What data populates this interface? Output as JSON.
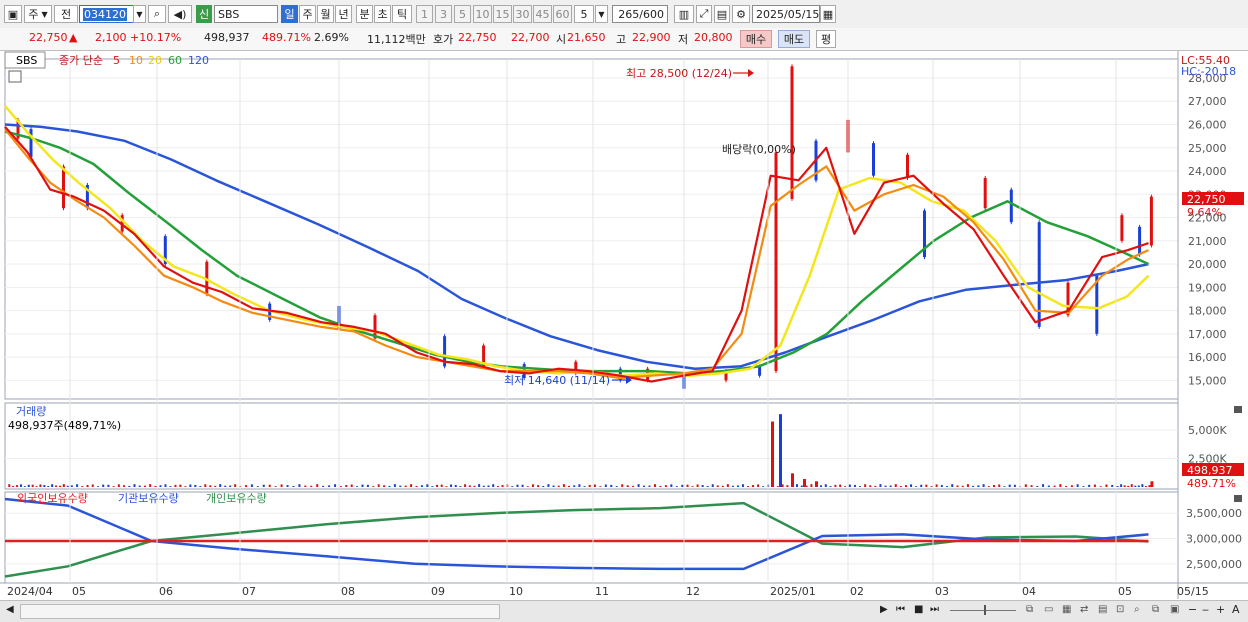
{
  "toolbar": {
    "period_unit": "주",
    "prev_label": "전",
    "code": "034120",
    "new_badge": "신",
    "stock_name": "SBS",
    "periods": [
      "일",
      "주",
      "월",
      "년",
      "분",
      "초",
      "틱"
    ],
    "active_period": "일",
    "intervals": [
      "1",
      "3",
      "5",
      "10",
      "15",
      "30",
      "45",
      "60"
    ],
    "interval_value": "5",
    "count": "265",
    "count_total": "/600",
    "date": "2025/05/15"
  },
  "quote": {
    "price": "22,750",
    "change_arrow": "▲",
    "change": "2,100",
    "change_pct": "+10.17%",
    "volume": "498,937",
    "volume_ratio": "489.71%",
    "turnover": "2.69%",
    "amount": "11,112백만",
    "bid_label": "호가",
    "ask_price": "22,750",
    "bid_price": "22,700",
    "open_label": "시",
    "open": "21,650",
    "high_label": "고",
    "high": "22,900",
    "low_label": "저",
    "low": "20,800",
    "buy_button": "매수",
    "sell_button": "매도",
    "eval_button": "평"
  },
  "colors": {
    "up": "#e01010",
    "down": "#1a3fd9",
    "ma5": "#e01010",
    "ma10": "#f28b10",
    "ma20": "#f4e61b",
    "ma60": "#23a038",
    "ma120": "#2a55d8",
    "foreign": "#e02020",
    "institution": "#2a55d8",
    "individual": "#2f8f4e"
  },
  "chart_data": [
    {
      "type": "candlestick",
      "title": "SBS",
      "series_label": "종가 단순",
      "ma_periods": [
        "5",
        "10",
        "20",
        "60",
        "120"
      ],
      "legend_labels": [
        "5",
        "10",
        "20",
        "60",
        "120"
      ],
      "ylim": [
        14000,
        28500
      ],
      "y_ticks": [
        "15,000",
        "16,000",
        "17,000",
        "18,000",
        "19,000",
        "20,000",
        "21,000",
        "22,000",
        "23,000",
        "24,000",
        "25,000",
        "26,000",
        "27,000",
        "28,000"
      ],
      "x_labels": [
        "2024/04",
        "05",
        "06",
        "07",
        "08",
        "09",
        "10",
        "11",
        "12",
        "2025/01",
        "02",
        "03",
        "04",
        "05",
        "05/15"
      ],
      "high_annotation": "최고 28,500 (12/24)",
      "low_annotation": "최저 14,640 (11/14)",
      "dividend_annotation": "배당락(0,00%)",
      "lc": "LC:55.40",
      "hc": "HC:-20.18",
      "last_price": "22,750",
      "last_change": "9.64%",
      "close_path": [
        [
          "2024/04",
          25800
        ],
        [
          "2024/04",
          24600
        ],
        [
          "2024/04",
          23100
        ],
        [
          "05",
          23000
        ],
        [
          "05",
          22400
        ],
        [
          "05",
          21500
        ],
        [
          "05",
          20000
        ],
        [
          "06",
          19200
        ],
        [
          "06",
          19100
        ],
        [
          "06",
          18700
        ],
        [
          "06",
          18000
        ],
        [
          "07",
          18200
        ],
        [
          "07",
          17600
        ],
        [
          "07",
          17300
        ],
        [
          "07",
          17200
        ],
        [
          "08",
          16900
        ],
        [
          "08",
          16000
        ],
        [
          "08",
          15600
        ],
        [
          "08",
          15800
        ],
        [
          "09",
          15900
        ],
        [
          "09",
          15300
        ],
        [
          "09",
          15200
        ],
        [
          "10",
          15500
        ],
        [
          "10",
          15600
        ],
        [
          "10",
          15400
        ],
        [
          "11",
          15300
        ],
        [
          "11",
          15000
        ],
        [
          "11",
          14800
        ],
        [
          "12",
          15200
        ],
        [
          "12",
          15300
        ],
        [
          "12",
          15500
        ],
        [
          "12",
          24500
        ],
        [
          "2025/01",
          23000
        ],
        [
          "2025/01",
          24500
        ],
        [
          "2025/01",
          25000
        ],
        [
          "02",
          21000
        ],
        [
          "02",
          23500
        ],
        [
          "02",
          24000
        ],
        [
          "03",
          23000
        ],
        [
          "03",
          22500
        ],
        [
          "03",
          21000
        ],
        [
          "04",
          18500
        ],
        [
          "04",
          17500
        ],
        [
          "04",
          18500
        ],
        [
          "05",
          20500
        ],
        [
          "05",
          20650
        ],
        [
          "05/15",
          22750
        ]
      ],
      "ma_paths": {
        "5": [
          25900,
          24800,
          23200,
          22900,
          22300,
          21300,
          19900,
          19200,
          18800,
          18100,
          17900,
          17500,
          17300,
          17000,
          16200,
          15800,
          15700,
          15400,
          15300,
          15500,
          15400,
          15200,
          14950,
          15200,
          15400,
          18000,
          23800,
          23600,
          25000,
          21300,
          23500,
          23800,
          22600,
          21500,
          19500,
          17500,
          18000,
          20300,
          20600,
          20900
        ],
        "10": [
          25800,
          24600,
          23500,
          22800,
          22000,
          20800,
          19500,
          19000,
          18400,
          17900,
          17600,
          17300,
          17100,
          16500,
          16000,
          15800,
          15600,
          15400,
          15400,
          15400,
          15300,
          15100,
          15200,
          15300,
          15500,
          17000,
          22500,
          23400,
          24200,
          22300,
          23000,
          23400,
          22900,
          21800,
          20200,
          18000,
          17900,
          19500,
          20200,
          20600
        ],
        "20": [
          26800,
          25600,
          24500,
          23500,
          22400,
          21000,
          19900,
          19400,
          18700,
          18000,
          17600,
          17300,
          17100,
          16600,
          16100,
          15900,
          15600,
          15400,
          15300,
          15400,
          15200,
          15300,
          15200,
          15300,
          15500,
          16500,
          19500,
          23200,
          23700,
          23500,
          22700,
          22300,
          21000,
          19000,
          18200,
          18100,
          18600,
          19500
        ],
        "60": [
          25700,
          25400,
          25000,
          24300,
          23000,
          21800,
          20600,
          19500,
          18600,
          17700,
          17100,
          16600,
          16100,
          15800,
          15600,
          15500,
          15400,
          15400,
          15400,
          15300,
          15400,
          15600,
          16200,
          17000,
          18400,
          19700,
          21000,
          22000,
          22700,
          21800,
          21200,
          20500,
          20000
        ],
        "120": [
          26000,
          25900,
          25700,
          25300,
          24500,
          23600,
          22700,
          21700,
          20700,
          19700,
          18500,
          17700,
          16900,
          16300,
          15800,
          15500,
          15600,
          16200,
          16900,
          17600,
          18400,
          18900,
          19100,
          19300,
          19700,
          20000
        ]
      },
      "bullish_candles": [
        [
          0.2,
          26200,
          25400
        ],
        [
          0.9,
          24200,
          22400
        ],
        [
          1.6,
          22100,
          21400
        ],
        [
          2.6,
          20100,
          18700
        ],
        [
          4.4,
          17800,
          16800
        ],
        [
          5.7,
          16500,
          15600
        ],
        [
          6.8,
          15800,
          15300
        ],
        [
          7.6,
          15500,
          15000
        ],
        [
          8.5,
          15400,
          15000
        ],
        [
          9.1,
          24800,
          15400
        ],
        [
          9.3,
          28500,
          22800
        ],
        [
          10.0,
          26200,
          24800
        ],
        [
          10.7,
          24700,
          23700
        ],
        [
          11.6,
          23700,
          22400
        ],
        [
          12.5,
          19200,
          17800
        ],
        [
          13.1,
          22100,
          21000
        ],
        [
          13.6,
          22900,
          20800
        ]
      ],
      "bearish_candles": [
        [
          0.4,
          25800,
          24600
        ],
        [
          1.2,
          23400,
          22400
        ],
        [
          2.1,
          21200,
          20000
        ],
        [
          3.3,
          18300,
          17600
        ],
        [
          4.0,
          18200,
          17200
        ],
        [
          5.2,
          16900,
          15600
        ],
        [
          6.2,
          15700,
          15100
        ],
        [
          7.3,
          15500,
          15000
        ],
        [
          8.0,
          15200,
          14640
        ],
        [
          8.9,
          15600,
          15200
        ],
        [
          9.6,
          25300,
          23600
        ],
        [
          10.3,
          25200,
          23800
        ],
        [
          10.9,
          22300,
          20300
        ],
        [
          11.9,
          23200,
          21800
        ],
        [
          12.2,
          21800,
          17300
        ],
        [
          12.8,
          19500,
          17000
        ],
        [
          13.4,
          21600,
          20400
        ]
      ],
      "volume": {
        "title": "거래량",
        "summary": "498,937주(489,71%)",
        "y_ticks": [
          "2,500K",
          "5,000K"
        ],
        "last_value": "498,937",
        "last_ratio": "489.71%",
        "spikes": [
          [
            9.05,
            5750000
          ],
          [
            9.15,
            6400000
          ],
          [
            9.3,
            1200000
          ],
          [
            9.45,
            700000
          ],
          [
            9.6,
            500000
          ],
          [
            13.6,
            498937
          ]
        ],
        "baseline": 180000
      }
    },
    {
      "type": "line",
      "title": "보유수량",
      "legend": [
        "외국인보유수량",
        "기관보유수량",
        "개인보유수량"
      ],
      "y_ticks": [
        "2,500,000",
        "3,000,000",
        "3,500,000"
      ],
      "ylim": [
        2200000,
        3800000
      ],
      "series": [
        {
          "name": "외국인보유수량",
          "values": [
            2950000,
            2950000,
            2950000,
            2950000,
            2950000,
            2950000,
            2950000,
            2950000,
            2950000,
            2950000,
            2950000,
            2950000,
            2950000,
            2950000
          ]
        },
        {
          "name": "기관보유수량",
          "values": [
            3780000,
            3650000,
            2950000,
            2800000,
            2650000,
            2500000,
            2450000,
            2420000,
            2400000,
            2400000,
            3050000,
            3080000,
            2980000,
            2950000,
            3080000
          ]
        },
        {
          "name": "개인보유수량",
          "values": [
            2250000,
            2450000,
            2950000,
            3100000,
            3280000,
            3420000,
            3500000,
            3560000,
            3600000,
            3700000,
            2900000,
            2830000,
            3020000,
            3040000,
            2940000
          ]
        }
      ]
    }
  ]
}
